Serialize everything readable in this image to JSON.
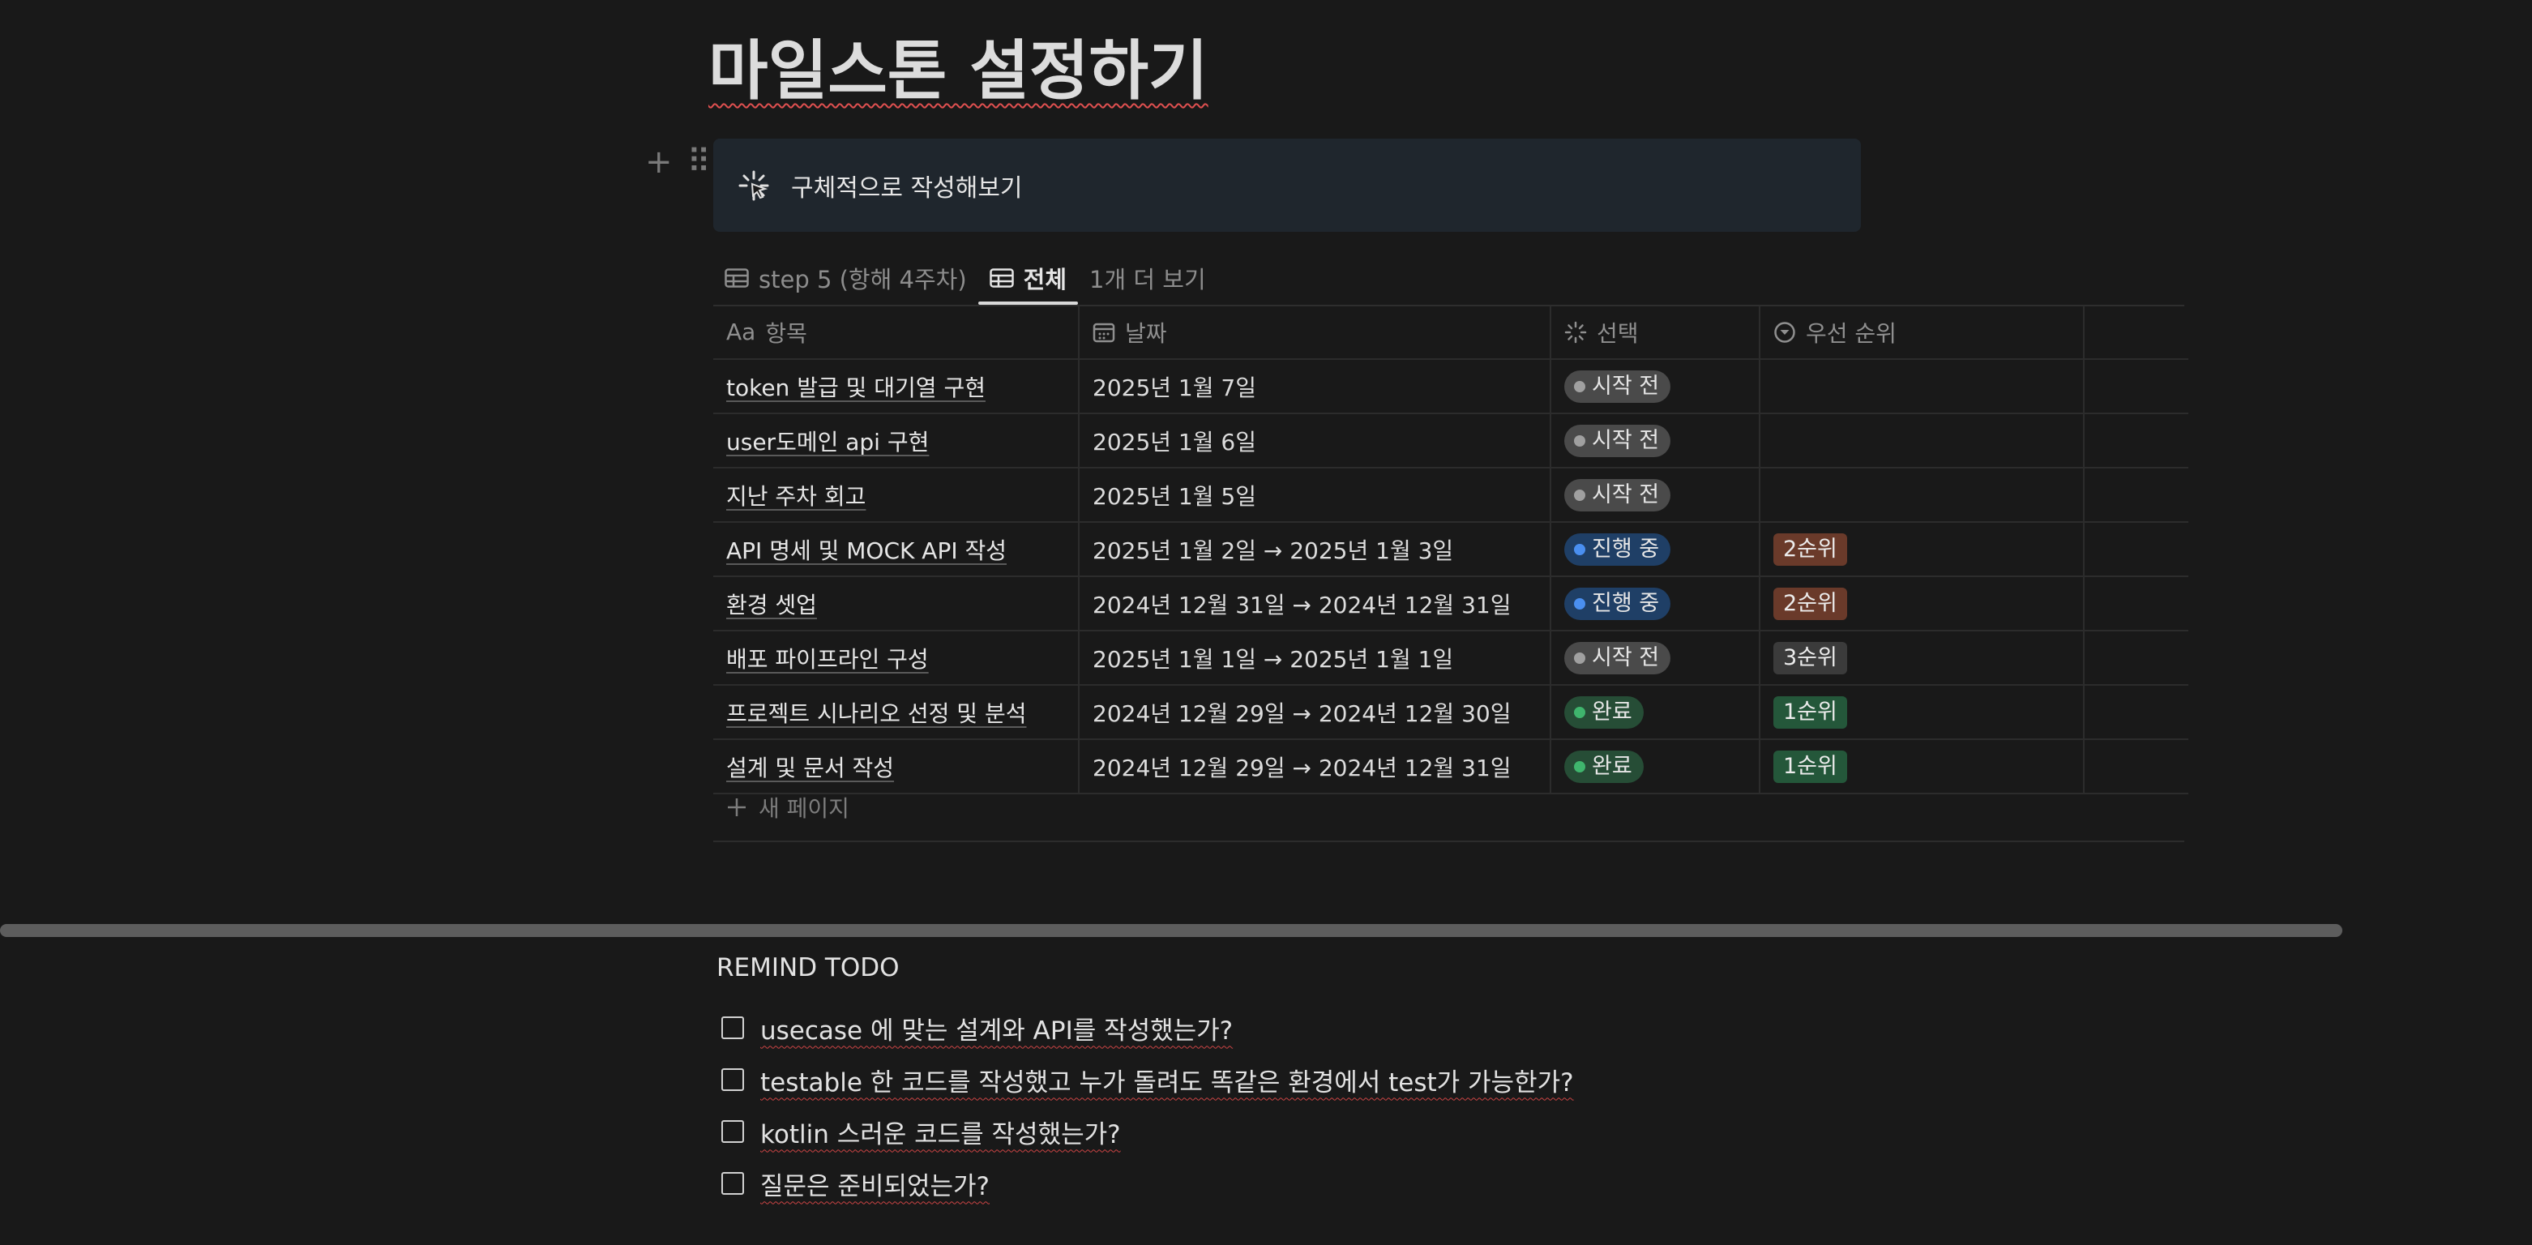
{
  "page": {
    "title": "마일스톤 설정하기"
  },
  "callout": {
    "icon": "loading-spinner-icon",
    "text": "구체적으로 작성해보기"
  },
  "tabs": [
    {
      "label": "step 5 (항해 4주차)",
      "icon": "table-icon",
      "active": false
    },
    {
      "label": "전체",
      "icon": "table-icon",
      "active": true
    },
    {
      "label": "1개 더 보기",
      "active": false
    }
  ],
  "table": {
    "headers": [
      {
        "label": "항목",
        "prefix": "Aa"
      },
      {
        "label": "날짜",
        "icon": "calendar-icon"
      },
      {
        "label": "선택",
        "icon": "status-icon"
      },
      {
        "label": "우선 순위",
        "icon": "select-icon"
      }
    ],
    "rows": [
      {
        "name": "token 발급 및 대기열 구현",
        "date": "2025년 1월 7일",
        "status": "시작 전",
        "status_color": "gray",
        "priority": ""
      },
      {
        "name": "user도메인 api 구현",
        "date": "2025년 1월 6일",
        "status": "시작 전",
        "status_color": "gray",
        "priority": ""
      },
      {
        "name": "지난 주차 회고",
        "date": "2025년 1월 5일",
        "status": "시작 전",
        "status_color": "gray",
        "priority": ""
      },
      {
        "name": "API 명세 및 MOCK API 작성",
        "date": "2025년 1월 2일 → 2025년 1월 3일",
        "status": "진행 중",
        "status_color": "blue",
        "priority": "2순위",
        "priority_color": "brown"
      },
      {
        "name": "환경 셋업",
        "date": "2024년 12월 31일 → 2024년 12월 31일",
        "status": "진행 중",
        "status_color": "blue",
        "priority": "2순위",
        "priority_color": "brown"
      },
      {
        "name": "배포 파이프라인 구성",
        "date": "2025년 1월 1일 → 2025년 1월 1일",
        "status": "시작 전",
        "status_color": "gray",
        "priority": "3순위",
        "priority_color": "gray"
      },
      {
        "name": "프로젝트 시나리오 선정 및 분석",
        "date": "2024년 12월 29일 → 2024년 12월 30일",
        "status": "완료",
        "status_color": "green",
        "priority": "1순위",
        "priority_color": "green"
      },
      {
        "name": "설계 및 문서 작성",
        "date": "2024년 12월 29일 → 2024년 12월 31일",
        "status": "완료",
        "status_color": "green",
        "priority": "1순위",
        "priority_color": "green"
      }
    ],
    "new_page_label": "새 페이지"
  },
  "remind": {
    "title": "REMIND TODO",
    "items": [
      {
        "text": "usecase 에 맞는 설계와 API를 작성했는가?",
        "checked": false
      },
      {
        "text": "testable 한 코드를 작성했고 누가 돌려도 똑같은 환경에서 test가 가능한가?",
        "checked": false
      },
      {
        "text": "kotlin 스러운 코드를 작성했는가?",
        "checked": false
      },
      {
        "text": "질문은 준비되었는가?",
        "checked": false
      }
    ]
  },
  "colors": {
    "background": "#191919",
    "callout_bg": "#1f262d",
    "blue": "#4a8ff0",
    "green": "#3fb56d",
    "brown": "#6a3a2a"
  }
}
